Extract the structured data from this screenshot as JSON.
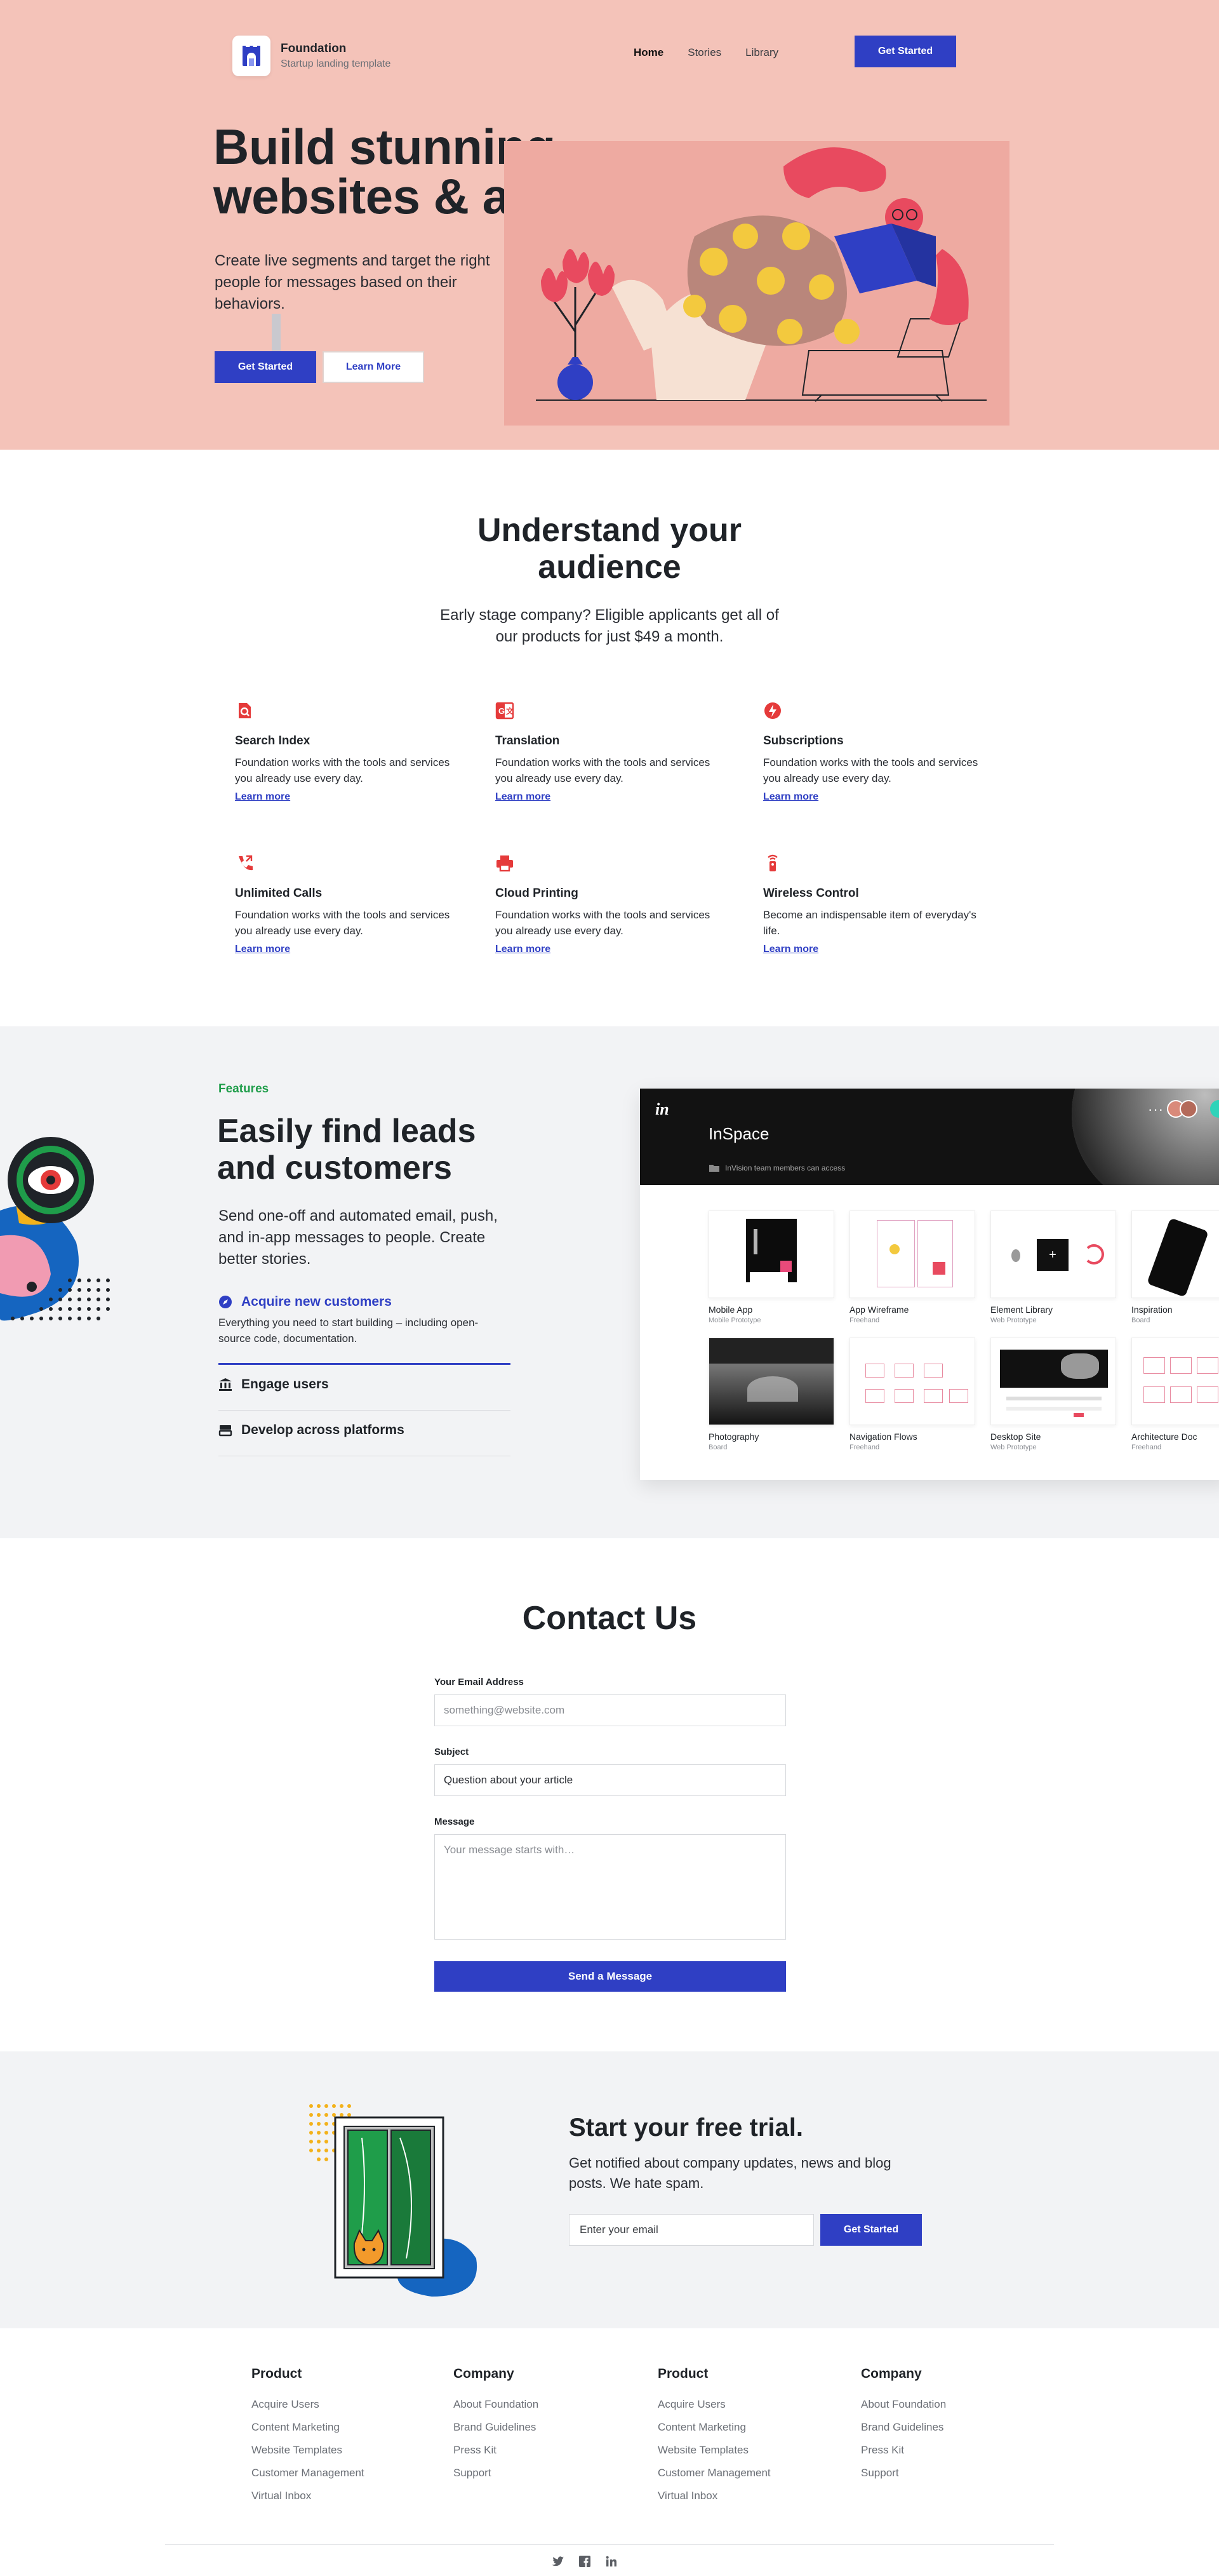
{
  "nav": {
    "brand_name": "Foundation",
    "brand_tagline": "Startup landing template",
    "links": [
      "Home",
      "Stories",
      "Library"
    ],
    "cta": "Get Started"
  },
  "hero": {
    "title_line1": "Build stunning",
    "title_line2": "websites & apps.",
    "description": "Create live segments and target the right people for messages based on their behaviors.",
    "primary_button": "Get Started",
    "secondary_button": "Learn More"
  },
  "understand": {
    "title_line1": "Understand your",
    "title_line2": "audience",
    "subtitle": "Early stage company? Eligible applicants get all of our products for just $49 a month.",
    "items": [
      {
        "title": "Search Index",
        "desc": "Foundation works with the tools and services you already use every day.",
        "link": "Learn more",
        "icon": "search-document-icon"
      },
      {
        "title": "Translation",
        "desc": "Foundation works with the tools and services you already use every day.",
        "link": "Learn more",
        "icon": "translate-icon"
      },
      {
        "title": "Subscriptions",
        "desc": "Foundation works with the tools and services you already use every day.",
        "link": "Learn more",
        "icon": "lightning-icon"
      },
      {
        "title": "Unlimited Calls",
        "desc": "Foundation works with the tools and services you already use every day.",
        "link": "Learn more",
        "icon": "phone-icon"
      },
      {
        "title": "Cloud Printing",
        "desc": "Foundation works with the tools and services you already use every day.",
        "link": "Learn more",
        "icon": "printer-icon"
      },
      {
        "title": "Wireless Control",
        "desc": "Become an indispensable item of everyday's life.",
        "link": "Learn more",
        "icon": "remote-icon"
      }
    ]
  },
  "features": {
    "eyebrow": "Features",
    "title_line1": "Easily find leads",
    "title_line2": "and customers",
    "description": "Send one-off and automated email, push, and in-app messages to people. Create better stories.",
    "accordion": [
      {
        "label": "Acquire new customers",
        "body": "Everything you need to start building – including open-source code, documentation.",
        "icon": "compass-icon",
        "active": true
      },
      {
        "label": "Engage users",
        "body": "",
        "icon": "bank-icon",
        "active": false
      },
      {
        "label": "Develop across platforms",
        "body": "",
        "icon": "layers-icon",
        "active": false
      }
    ],
    "app": {
      "logo": "in",
      "title": "InSpace",
      "subtitle": "InVision team members can access",
      "cards": [
        {
          "name": "Mobile App",
          "type": "Mobile Prototype"
        },
        {
          "name": "App Wireframe",
          "type": "Freehand"
        },
        {
          "name": "Element Library",
          "type": "Web Prototype"
        },
        {
          "name": "Inspiration",
          "type": "Board"
        },
        {
          "name": "Photography",
          "type": "Board"
        },
        {
          "name": "Navigation Flows",
          "type": "Freehand"
        },
        {
          "name": "Desktop Site",
          "type": "Web Prototype"
        },
        {
          "name": "Architecture Doc",
          "type": "Freehand"
        }
      ]
    }
  },
  "contact": {
    "title": "Contact Us",
    "email_label": "Your Email Address",
    "email_placeholder": "something@website.com",
    "subject_label": "Subject",
    "subject_value": "Question about your article",
    "message_label": "Message",
    "message_placeholder": "Your message starts with…",
    "submit": "Send a Message"
  },
  "trial": {
    "title": "Start your free trial.",
    "description": "Get notified about company updates, news and blog posts. We hate spam.",
    "email_placeholder": "Enter your email",
    "button": "Get Started"
  },
  "footer": {
    "columns": [
      {
        "title": "Product",
        "links": [
          "Acquire Users",
          "Content Marketing",
          "Website Templates",
          "Customer Management",
          "Virtual Inbox"
        ]
      },
      {
        "title": "Company",
        "links": [
          "About Foundation",
          "Brand Guidelines",
          "Press Kit",
          "Support"
        ]
      },
      {
        "title": "Product",
        "links": [
          "Acquire Users",
          "Content Marketing",
          "Website Templates",
          "Customer Management",
          "Virtual Inbox"
        ]
      },
      {
        "title": "Company",
        "links": [
          "About Foundation",
          "Brand Guidelines",
          "Press Kit",
          "Support"
        ]
      }
    ],
    "social": [
      "twitter-icon",
      "facebook-icon",
      "linkedin-icon"
    ]
  },
  "colors": {
    "hero_bg": "#f4c3b9",
    "primary": "#2f3fc4",
    "accent_red": "#e53a3a",
    "features_green": "#1f9d4a",
    "muted_bg": "#f2f3f5"
  }
}
